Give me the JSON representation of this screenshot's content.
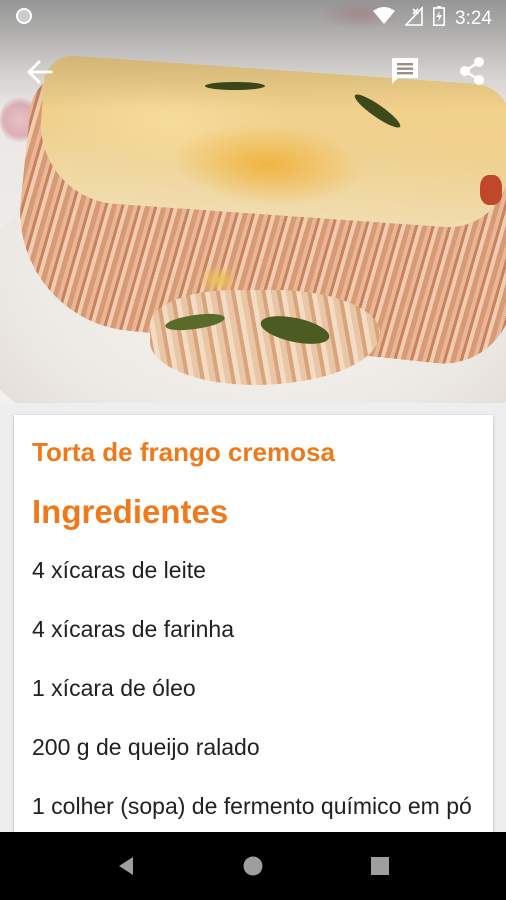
{
  "status_bar": {
    "time": "3:24",
    "icons": [
      "notification-dot-icon",
      "wifi-icon",
      "no-signal-icon",
      "battery-icon"
    ]
  },
  "app_bar": {
    "icons": [
      "back-arrow-icon",
      "comment-icon",
      "share-icon"
    ]
  },
  "recipe": {
    "title": "Torta de frango cremosa",
    "section_heading": "Ingredientes",
    "ingredients": [
      "4 xícaras de leite",
      "4 xícaras de farinha",
      "1 xícara de óleo",
      "200 g de queijo ralado",
      "1 colher (sopa) de fermento químico em pó"
    ]
  },
  "nav_bar": {
    "icons": [
      "back-triangle-icon",
      "home-circle-icon",
      "recents-square-icon"
    ]
  },
  "colors": {
    "accent": "#f07a1a",
    "text": "#212121",
    "card": "#ffffff",
    "background": "#eeeeee",
    "nav": "#000000"
  }
}
